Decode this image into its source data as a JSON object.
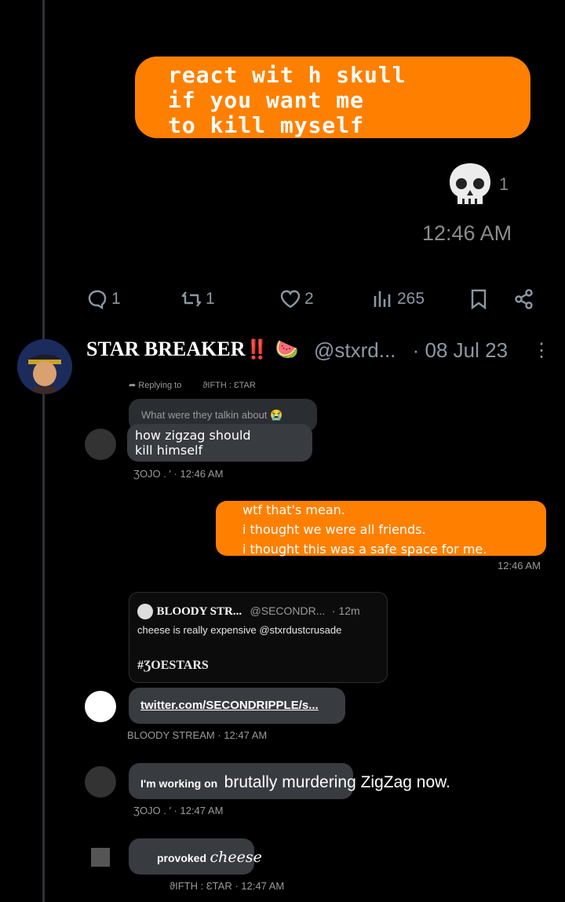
{
  "top_message": {
    "text": "react wit h skull\nif you want me\nto kill myself",
    "reaction_count": "1",
    "timestamp": "12:46 AM"
  },
  "actions": {
    "replies": "1",
    "reposts": "1",
    "likes": "2",
    "views": "265"
  },
  "reply": {
    "name": "STAR BREAKER",
    "emoji": "‼️ 🍉",
    "handle": "@stxrd...",
    "date": "· 08 Jul 23",
    "more": "⋮"
  },
  "chat": {
    "replying_to": "Replying to",
    "replying_to_name": "ϑIFTH : ƐTAR",
    "quoted_question": "What were they talkin about 😭",
    "msg1": "how zigzag should\nkill himself",
    "msg1_meta": "ƷOJO . ′ · 12:46 AM",
    "orange_lines": [
      "wtf that's mean.",
      "i thought we were all friends.",
      "i thought this was a safe space for me."
    ],
    "orange_time": "12:46 AM",
    "quote_name": "BLOODY STR...",
    "quote_handle": "@SECONDR...",
    "quote_time": "· 12m",
    "quote_text": "cheese is really expensive @stxrdustcrusade",
    "quote_tag": "#ƷOESTARS",
    "link": "twitter.com/SECONDRIPPLE/s...",
    "link_meta": "BLOODY STREAM · 12:47 AM",
    "msg3_a": "I'm working on",
    "msg3_b": "brutally murdering ZigZag now.",
    "msg3_meta": "ƷOJO . ′ · 12:47 AM",
    "msg4_a": "provoked",
    "msg4_b": "cheese",
    "msg4_meta": "ϑIFTH : ƐTAR · 12:47 AM"
  },
  "colors": {
    "accent": "#ff8000",
    "muted": "#8b98a5",
    "background": "#000000"
  }
}
